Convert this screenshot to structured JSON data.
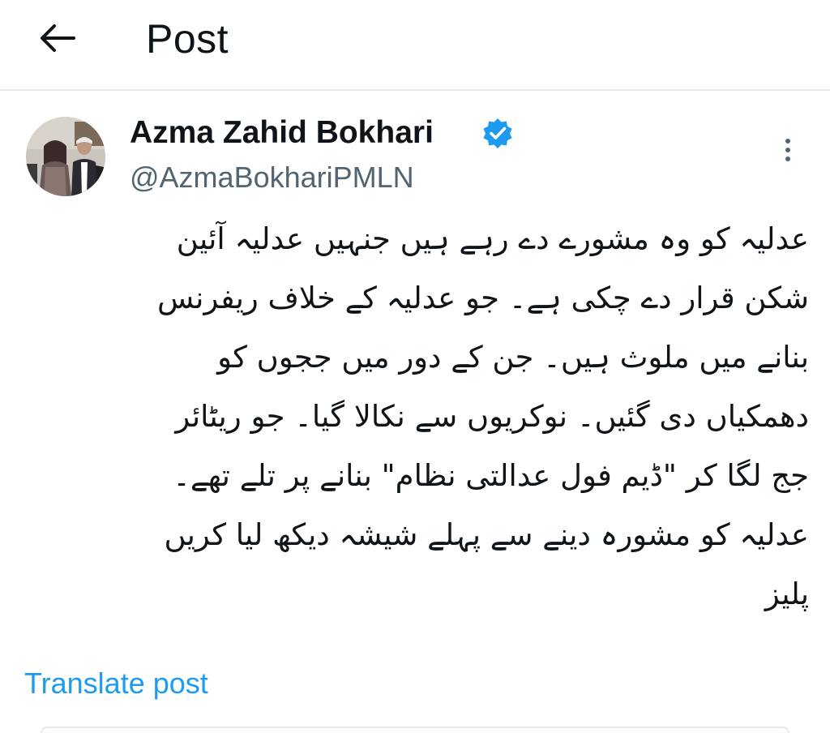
{
  "header": {
    "title": "Post",
    "back_icon": "arrow-left-icon"
  },
  "post": {
    "author_name": "Azma Zahid Bokhari",
    "verified_icon": "verified-badge-icon",
    "verified_color": "#1d9bf0",
    "handle": "@AzmaBokhariPMLN",
    "more_icon": "more-options-icon",
    "lines": [
      "عدلیہ کو وہ مشورے دے رہے ہیں جنہیں عدلیہ آئین",
      "شکن قرار دے چکی ہے۔ جو عدلیہ کے خلاف ریفرنس",
      "بنانے میں ملوث ہیں۔ جن کے دور میں ججوں کو",
      "دھمکیاں دی گئیں۔ نوکریوں سے نکالا گیا۔ جو ریٹائر",
      "جج لگا کر \"ڈیم فول عدالتی نظام\" بنانے پر تلے تھے۔",
      "عدلیہ کو مشورہ دینے سے پہلے شیشہ دیکھ لیا کریں",
      "پلیز"
    ],
    "translate_label": "Translate post"
  },
  "colors": {
    "text": "#0f1419",
    "secondary": "#536471",
    "link": "#1d9bf0",
    "divider": "#e6e9ec"
  }
}
